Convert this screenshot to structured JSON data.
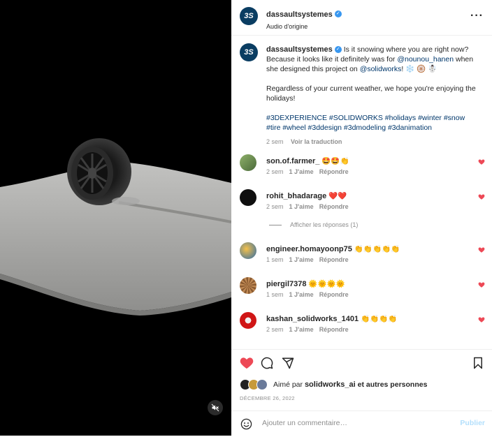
{
  "post": {
    "author": "dassaultsystemes",
    "audio": "Audio d'origine",
    "caption_text": "Is it snowing where you are right now? Because it looks like it definitely was for",
    "caption_mention1": "@nounou_hanen",
    "caption_text2": "when she designed this project on",
    "caption_mention2": "@solidworks",
    "caption_text3": "! ❄️ 🛞 ☃️",
    "caption_para2": "Regardless of your current weather, we hope you're enjoying the holidays!",
    "hashtags": "#3DEXPERIENCE #SOLIDWORKS #holidays #winter #snow #tire #wheel #3ddesign #3dmodeling #3danimation",
    "caption_age": "2 sem",
    "translate_label": "Voir la traduction",
    "avatar_text": "3S"
  },
  "comments": [
    {
      "user": "son.of.farmer_",
      "text": "🤩🤩👏",
      "age": "2 sem",
      "likes": "1 J'aime",
      "reply": "Répondre",
      "avatar_color": "#6a8a4a"
    },
    {
      "user": "rohit_bhadarage",
      "text": "❤️❤️",
      "age": "2 sem",
      "likes": "1 J'aime",
      "reply": "Répondre",
      "avatar_color": "#0f0f0f"
    },
    {
      "user": "engineer.homayoonp75",
      "text": "👏👏👏👏👏",
      "age": "1 sem",
      "likes": "1 J'aime",
      "reply": "Répondre",
      "avatar_color": "#e89b2c"
    },
    {
      "user": "piergil7378",
      "text": "🌞🌞🌞🌞",
      "age": "1 sem",
      "likes": "1 J'aime",
      "reply": "Répondre",
      "avatar_color": "#b07a4a"
    },
    {
      "user": "kashan_solidworks_1401",
      "text": "👏👏👏👏",
      "age": "2 sem",
      "likes": "1 J'aime",
      "reply": "Répondre",
      "avatar_color": "#d01616"
    }
  ],
  "show_replies": "Afficher les réponses (1)",
  "likes": {
    "liked_by_prefix": "Aimé par",
    "liked_by_user": "solidworks_ai",
    "liked_by_suffix": "et autres personnes"
  },
  "date": "DÉCEMBRE 26, 2022",
  "add_comment": {
    "placeholder": "Ajouter un commentaire…",
    "publish_label": "Publier"
  },
  "colors": {
    "heart_red": "#ed4956",
    "link_blue": "#00376b",
    "verified_blue": "#3897f0"
  },
  "icons": [
    "muted-speaker-icon",
    "more-options-icon",
    "heart-icon",
    "comment-icon",
    "share-icon",
    "bookmark-icon",
    "emoji-icon",
    "verified-icon"
  ]
}
